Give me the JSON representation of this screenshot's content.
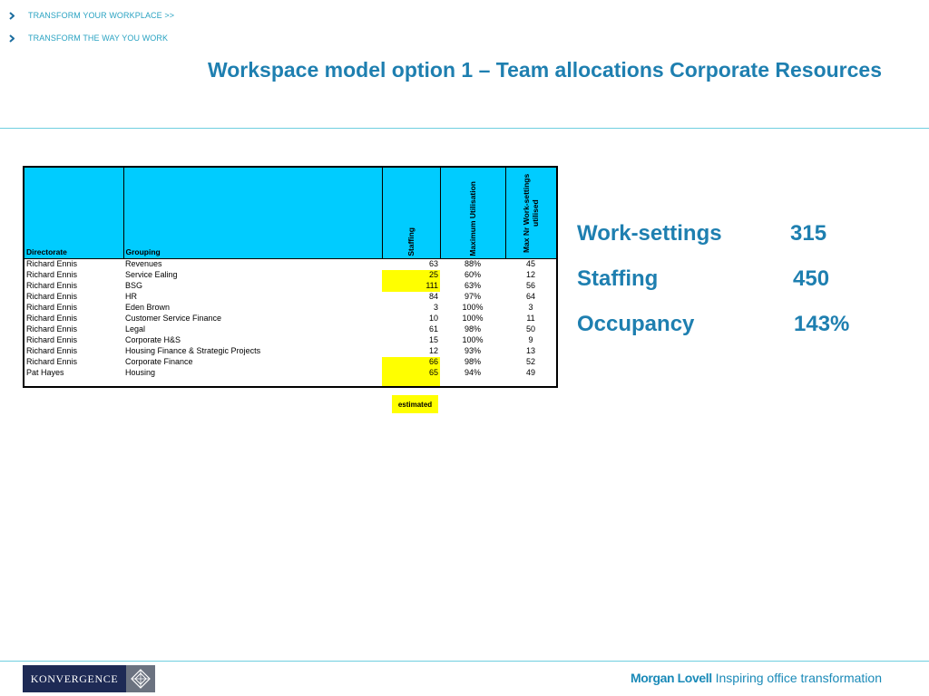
{
  "nav": {
    "items": [
      {
        "label": "TRANSFORM YOUR WORKPLACE >>"
      },
      {
        "label": "TRANSFORM THE WAY YOU WORK"
      }
    ]
  },
  "title": "Workspace model option 1 – Team allocations Corporate Resources",
  "table": {
    "headers": {
      "directorate": "Directorate",
      "grouping": "Grouping",
      "staffing": "Staffing",
      "max_utilisation": "Maximum Utilisation",
      "max_nr_worksettings": "Max Nr Work-settings utilised"
    },
    "rows": [
      {
        "directorate": "Richard Ennis",
        "grouping": "Revenues",
        "staffing": "63",
        "utilisation": "88%",
        "worksettings": "45",
        "estimated": false
      },
      {
        "directorate": "Richard Ennis",
        "grouping": "Service Ealing",
        "staffing": "25",
        "utilisation": "60%",
        "worksettings": "12",
        "estimated": true
      },
      {
        "directorate": "Richard Ennis",
        "grouping": "BSG",
        "staffing": "111",
        "utilisation": "63%",
        "worksettings": "56",
        "estimated": true
      },
      {
        "directorate": "Richard Ennis",
        "grouping": "HR",
        "staffing": "84",
        "utilisation": "97%",
        "worksettings": "64",
        "estimated": false
      },
      {
        "directorate": "Richard Ennis",
        "grouping": "Eden Brown",
        "staffing": "3",
        "utilisation": "100%",
        "worksettings": "3",
        "estimated": false
      },
      {
        "directorate": "Richard Ennis",
        "grouping": "Customer Service Finance",
        "staffing": "10",
        "utilisation": "100%",
        "worksettings": "11",
        "estimated": false
      },
      {
        "directorate": "Richard Ennis",
        "grouping": "Legal",
        "staffing": "61",
        "utilisation": "98%",
        "worksettings": "50",
        "estimated": false
      },
      {
        "directorate": "Richard Ennis",
        "grouping": "Corporate H&S",
        "staffing": "15",
        "utilisation": "100%",
        "worksettings": "9",
        "estimated": false
      },
      {
        "directorate": "Richard Ennis",
        "grouping": "Housing Finance & Strategic Projects",
        "staffing": "12",
        "utilisation": "93%",
        "worksettings": "13",
        "estimated": false
      },
      {
        "directorate": "Richard Ennis",
        "grouping": "Corporate Finance",
        "staffing": "66",
        "utilisation": "98%",
        "worksettings": "52",
        "estimated": true
      },
      {
        "directorate": "Pat Hayes",
        "grouping": "Housing",
        "staffing": "65",
        "utilisation": "94%",
        "worksettings": "49",
        "estimated": true
      }
    ]
  },
  "legend": {
    "estimated_label": "estimated"
  },
  "kpis": [
    {
      "label": "Work-settings",
      "value": "315"
    },
    {
      "label": "Staffing",
      "value": "450"
    },
    {
      "label": "Occupancy",
      "value": "143%"
    }
  ],
  "footer": {
    "konvergence_logo_text": "KONVERGENCE",
    "morgan_lovell_brand": "Morgan Lovell",
    "morgan_lovell_tagline": "Inspiring office transformation"
  },
  "colors": {
    "accent_blue": "#1e7fb0",
    "nav_teal": "#2aa3c2",
    "header_cyan": "#00ccff",
    "highlight_yellow": "#ffff00",
    "konvergence_navy": "#1e2a55"
  }
}
